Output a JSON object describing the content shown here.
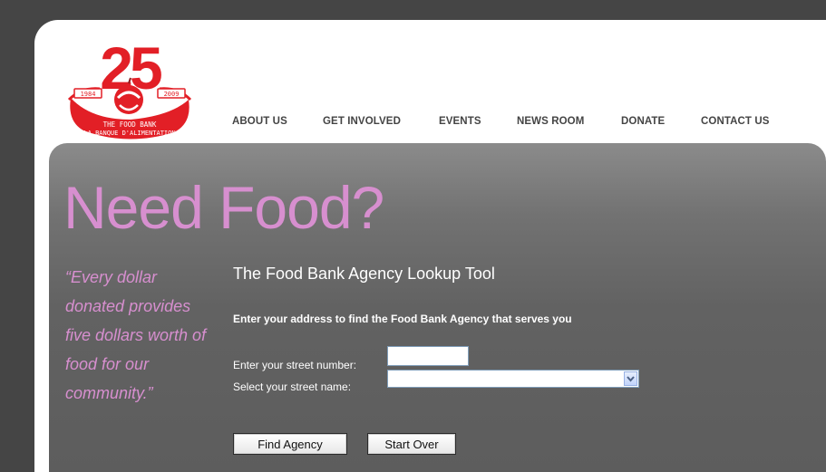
{
  "brand": {
    "anniversary": "25",
    "year_start": "1984",
    "year_end": "2009",
    "name_en": "THE FOOD BANK",
    "name_fr": "LA BANQUE D'ALIMENTATION",
    "color_red": "#e21f26"
  },
  "nav": {
    "items": [
      "ABOUT US",
      "GET INVOLVED",
      "EVENTS",
      "NEWS ROOM",
      "DONATE",
      "CONTACT US"
    ]
  },
  "hero": {
    "title": "Need Food?",
    "quote": "“Every dollar donated provides five dollars worth of food for our community.”"
  },
  "tool": {
    "title": "The Food Bank Agency Lookup Tool",
    "description": "Enter your address to find the Food Bank Agency that serves you",
    "street_number_label": "Enter your street number:",
    "street_number_value": "",
    "street_name_label": "Select your street name:",
    "street_name_value": "",
    "find_button": "Find Agency",
    "start_over_button": "Start Over"
  },
  "colors": {
    "accent_pink": "#d78fcf"
  }
}
